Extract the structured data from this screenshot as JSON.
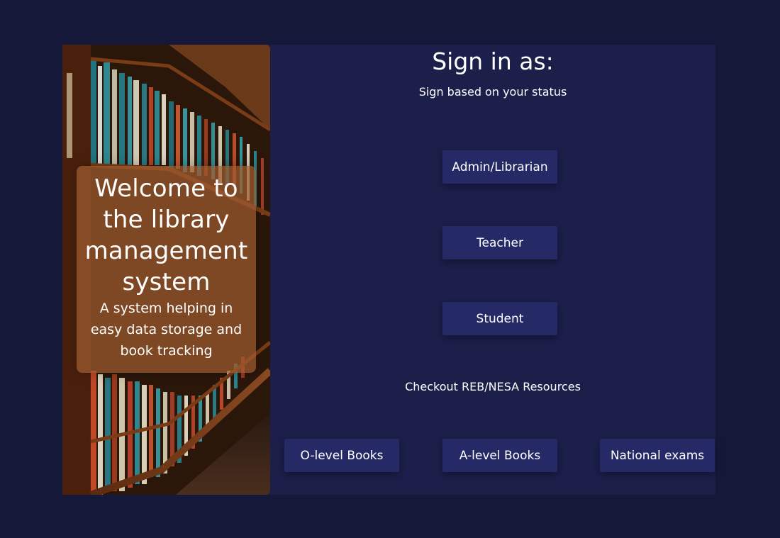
{
  "hero": {
    "title": "Welcome to the library management system",
    "subtitle": "A system helping in easy data storage and book tracking"
  },
  "signin": {
    "title": "Sign in as:",
    "subtitle": "Sign based on your status",
    "roles": {
      "admin": "Admin/Librarian",
      "teacher": "Teacher",
      "student": "Student"
    }
  },
  "resources": {
    "label": "Checkout REB/NESA Resources",
    "olevel": "O-level Books",
    "alevel": "A-level Books",
    "exams": "National exams"
  },
  "colors": {
    "page_bg": "#151839",
    "card_bg": "#1b1f4a",
    "button_bg": "#252a66",
    "overlay_bg": "#a05c30"
  }
}
